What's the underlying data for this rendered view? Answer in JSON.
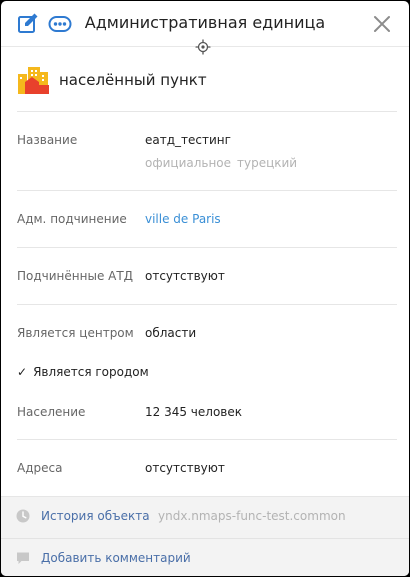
{
  "header": {
    "title": "Административная единица",
    "edit_icon": "edit-icon",
    "more_icon": "more-icon",
    "close_icon": "close-icon",
    "accent_color": "#2e7ad1"
  },
  "object_type": {
    "label": "населённый пункт",
    "icon": "city-buildings-icon"
  },
  "fields": {
    "name": {
      "label": "Название",
      "value": "еатд_тестинг",
      "sub_type": "официальное",
      "sub_lang": "турецкий"
    },
    "subordination": {
      "label": "Адм. подчинение",
      "value": "ville de Paris"
    },
    "subordinates": {
      "label": "Подчинённые АТД",
      "value": "отсутствуют"
    },
    "center_of": {
      "label": "Является центром",
      "value": "области"
    },
    "is_city": {
      "mark": "✓",
      "label": "Является городом"
    },
    "population": {
      "label": "Население",
      "value": "12 345 человек"
    },
    "addresses": {
      "label": "Адреса",
      "value": "отсутствуют"
    }
  },
  "footer": {
    "history_label": "История объекта",
    "history_source": "yndx.nmaps-func-test.common",
    "comment_label": "Добавить комментарий"
  }
}
